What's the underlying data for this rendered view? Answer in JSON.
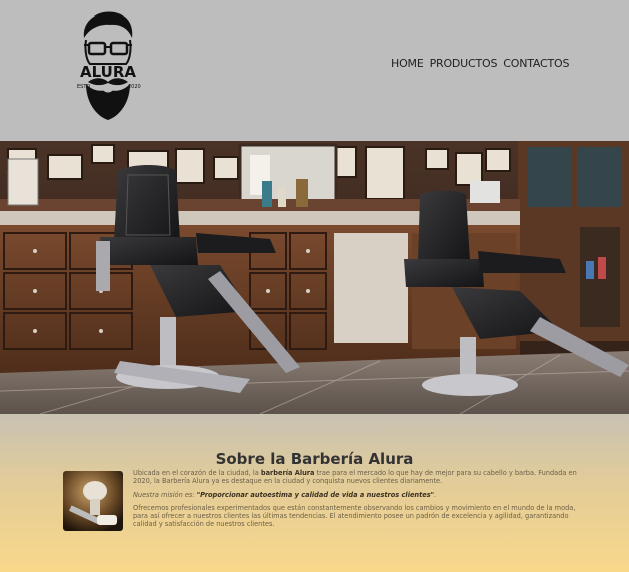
{
  "brand": {
    "name": "ALURA",
    "est": "ESTD",
    "year": "2020"
  },
  "nav": {
    "items": [
      {
        "label": "HOME"
      },
      {
        "label": "PRODUCTOS"
      },
      {
        "label": "CONTACTOS"
      }
    ]
  },
  "hero": {
    "icon": "barber-shop-photo"
  },
  "about": {
    "title": "Sobre la Barbería Alura",
    "p1_pre": "Ubicada en el corazón de la ciudad, la ",
    "p1_bold": "barbería Alura",
    "p1_post": " trae para el mercado lo que hay de mejor para su cabello y barba. Fundada en 2020, la Barbería Alura ya es destaque en la ciudad y conquista nuevos clientes diariamente.",
    "mission_label": "Nuestra misión es: ",
    "mission_text": "\"Proporcionar autoestima y calidad de vida a nuestros clientes\"",
    "mission_end": ".",
    "p3": "Ofrecemos profesionales experimentados que están constantemente observando los cambios y movimiento en el mundo de la moda, para así ofrecer a nuestros clientes las últimas tendencias. El atendimiento posee un padrón de excelencia y agilidad, garantizando calidad y satisfacción de nuestros clientes."
  },
  "colors": {
    "header_bg": "#bdbdbd",
    "gradient_bottom": "#f9d88a"
  }
}
